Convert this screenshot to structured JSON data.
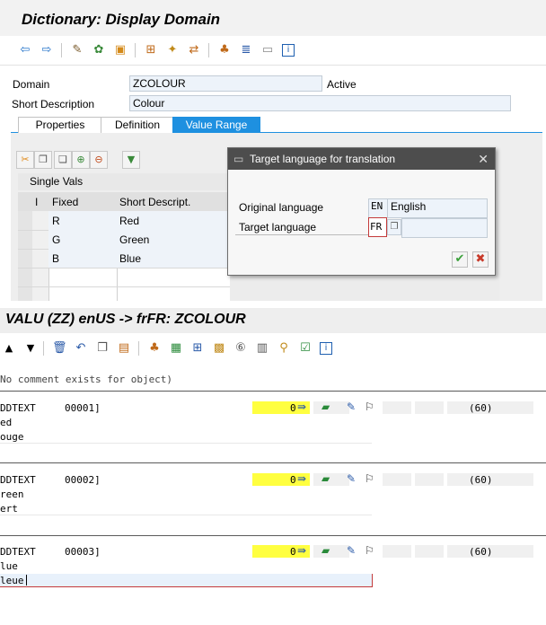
{
  "app_title": "Dictionary: Display Domain",
  "toolbar_icons": [
    "back-icon",
    "forward-icon",
    "glasses-icon",
    "change-display-icon",
    "activate-icon",
    "where-used-icon",
    "object-list-icon",
    "move-icon",
    "hierarchy-icon",
    "table-icon",
    "display-info-icon",
    "info-icon"
  ],
  "header": {
    "domain_label": "Domain",
    "domain_value": "ZCOLOUR",
    "status": "Active",
    "short_desc_label": "Short Description",
    "short_desc_value": "Colour"
  },
  "tabs": [
    {
      "label": "Properties",
      "active": false
    },
    {
      "label": "Definition",
      "active": false
    },
    {
      "label": "Value Range",
      "active": true
    }
  ],
  "single_vals": {
    "title": "Single Vals",
    "col_i": "I",
    "col_fixed": "Fixed",
    "col_desc": "Short Descript.",
    "rows": [
      {
        "fixed": "R",
        "desc": "Red"
      },
      {
        "fixed": "G",
        "desc": "Green"
      },
      {
        "fixed": "B",
        "desc": "Blue"
      }
    ]
  },
  "dialog": {
    "title": "Target language for translation",
    "original_label": "Original language",
    "original_code": "EN",
    "original_name": "English",
    "target_label": "Target language",
    "target_code": "FR"
  },
  "translation": {
    "title": "VALU (ZZ) enUS -> frFR: ZCOLOUR",
    "comment": "No comment exists for object)",
    "entries": [
      {
        "key": "DDTEXT",
        "number": "00001]",
        "count": "0",
        "length": "(60)",
        "source": "ed",
        "target": "ouge"
      },
      {
        "key": "DDTEXT",
        "number": "00002]",
        "count": "0",
        "length": "(60)",
        "source": "reen",
        "target": "ert"
      },
      {
        "key": "DDTEXT",
        "number": "00003]",
        "count": "0",
        "length": "(60)",
        "source": "lue",
        "target": "leue"
      }
    ]
  },
  "colors": {
    "accent": "#1e90e0",
    "highlight": "#ffff40"
  }
}
